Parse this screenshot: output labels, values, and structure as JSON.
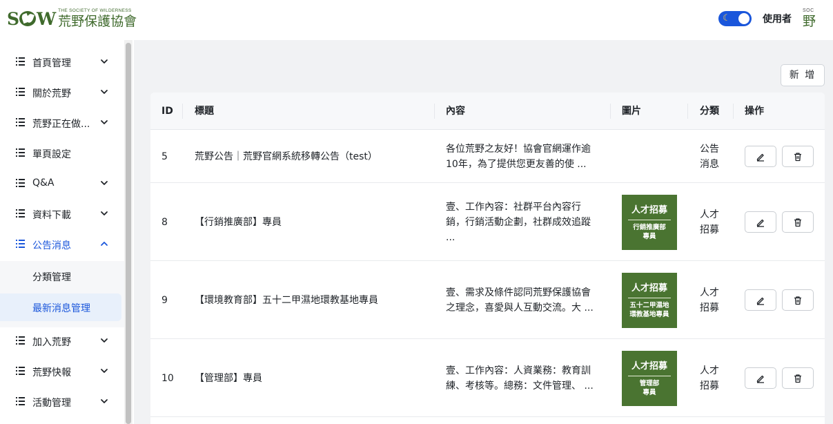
{
  "header": {
    "logo_mark": "SOW",
    "logo_subtitle": "THE SOCIETY OF WILDERNESS",
    "logo_name": "荒野保護協會",
    "user_label": "使用者",
    "avatar_top": "SOC",
    "avatar_char": "野",
    "theme_toggle_on": true
  },
  "sidebar": {
    "items": [
      {
        "label": "首頁管理",
        "chevron": "down"
      },
      {
        "label": "關於荒野",
        "chevron": "down"
      },
      {
        "label": "荒野正在做...",
        "chevron": "down"
      },
      {
        "label": "單頁設定",
        "chevron": ""
      },
      {
        "label": "Q&A",
        "chevron": "down"
      },
      {
        "label": "資料下載",
        "chevron": "down"
      },
      {
        "label": "公告消息",
        "chevron": "up",
        "active": true
      },
      {
        "label": "加入荒野",
        "chevron": "down"
      },
      {
        "label": "荒野快報",
        "chevron": "down"
      },
      {
        "label": "活動管理",
        "chevron": "down"
      }
    ],
    "sub_items": [
      {
        "label": "分類管理"
      },
      {
        "label": "最新消息管理",
        "selected": true
      }
    ]
  },
  "toolbar": {
    "add_label": "新 增"
  },
  "table": {
    "columns": [
      "ID",
      "標題",
      "內容",
      "圖片",
      "分類",
      "操作"
    ],
    "rows": [
      {
        "id": "5",
        "title": "荒野公告｜荒野官網系統移轉公告（test）",
        "content_lines": [
          "各位荒野之友好！協會官網運作逾",
          "10年，為了提供您更友善的使 ..."
        ],
        "image": null,
        "category_lines": [
          "公告",
          "消息"
        ]
      },
      {
        "id": "8",
        "title": "【行銷推廣部】專員",
        "content_lines": [
          "壹、工作內容：社群平台內容行",
          "銷，行銷活動企劃，社群成效追蹤",
          "..."
        ],
        "image": {
          "line1": "人才招募",
          "line2": [
            "行銷推廣部",
            "專員"
          ]
        },
        "category_lines": [
          "人才",
          "招募"
        ]
      },
      {
        "id": "9",
        "title": "【環境教育部】五十二甲濕地環教基地專員",
        "content_lines": [
          "壹、需求及條件認同荒野保護協會",
          "之理念，喜愛與人互動交流。大 ..."
        ],
        "image": {
          "line1": "人才招募",
          "line2": [
            "五十二甲濕地",
            "環教基地專員"
          ]
        },
        "category_lines": [
          "人才",
          "招募"
        ]
      },
      {
        "id": "10",
        "title": "【管理部】專員",
        "content_lines": [
          "壹、工作內容：人資業務：教育訓",
          "練、考核等。總務：文件管理、 ..."
        ],
        "image": {
          "line1": "人才招募",
          "line2": [
            "管理部",
            "專員"
          ]
        },
        "category_lines": [
          "人才",
          "招募"
        ]
      }
    ]
  },
  "colors": {
    "brand_green": "#3f6a2c",
    "accent_blue": "#1a56db",
    "thumb_green": "#4a7431"
  },
  "icons": [
    "list-icon",
    "chevron-down-icon",
    "chevron-up-icon",
    "edit-icon",
    "trash-icon",
    "moon-icon"
  ]
}
